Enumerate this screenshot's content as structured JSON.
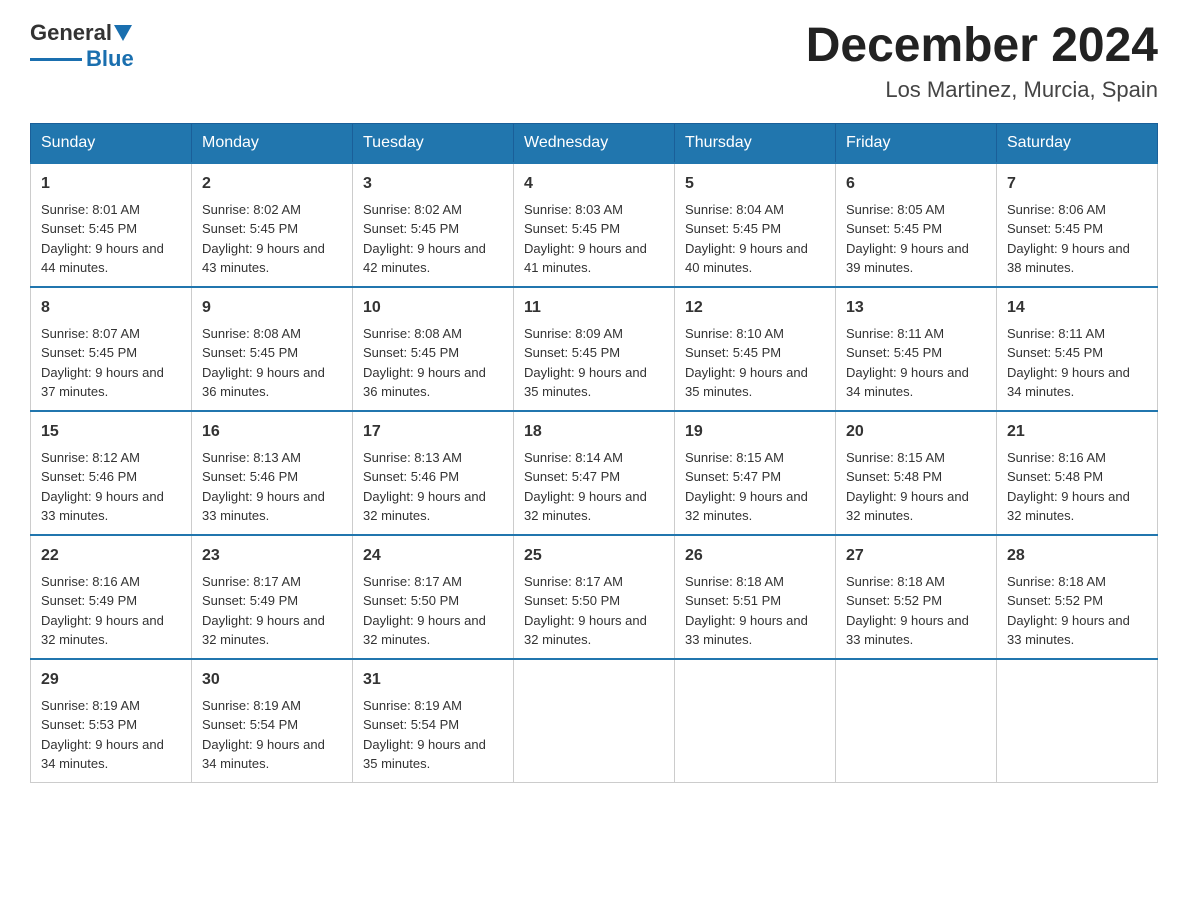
{
  "header": {
    "logo_general": "General",
    "logo_blue": "Blue",
    "month_title": "December 2024",
    "location": "Los Martinez, Murcia, Spain"
  },
  "days_of_week": [
    "Sunday",
    "Monday",
    "Tuesday",
    "Wednesday",
    "Thursday",
    "Friday",
    "Saturday"
  ],
  "weeks": [
    [
      {
        "day": "1",
        "sunrise": "8:01 AM",
        "sunset": "5:45 PM",
        "daylight": "9 hours and 44 minutes."
      },
      {
        "day": "2",
        "sunrise": "8:02 AM",
        "sunset": "5:45 PM",
        "daylight": "9 hours and 43 minutes."
      },
      {
        "day": "3",
        "sunrise": "8:02 AM",
        "sunset": "5:45 PM",
        "daylight": "9 hours and 42 minutes."
      },
      {
        "day": "4",
        "sunrise": "8:03 AM",
        "sunset": "5:45 PM",
        "daylight": "9 hours and 41 minutes."
      },
      {
        "day": "5",
        "sunrise": "8:04 AM",
        "sunset": "5:45 PM",
        "daylight": "9 hours and 40 minutes."
      },
      {
        "day": "6",
        "sunrise": "8:05 AM",
        "sunset": "5:45 PM",
        "daylight": "9 hours and 39 minutes."
      },
      {
        "day": "7",
        "sunrise": "8:06 AM",
        "sunset": "5:45 PM",
        "daylight": "9 hours and 38 minutes."
      }
    ],
    [
      {
        "day": "8",
        "sunrise": "8:07 AM",
        "sunset": "5:45 PM",
        "daylight": "9 hours and 37 minutes."
      },
      {
        "day": "9",
        "sunrise": "8:08 AM",
        "sunset": "5:45 PM",
        "daylight": "9 hours and 36 minutes."
      },
      {
        "day": "10",
        "sunrise": "8:08 AM",
        "sunset": "5:45 PM",
        "daylight": "9 hours and 36 minutes."
      },
      {
        "day": "11",
        "sunrise": "8:09 AM",
        "sunset": "5:45 PM",
        "daylight": "9 hours and 35 minutes."
      },
      {
        "day": "12",
        "sunrise": "8:10 AM",
        "sunset": "5:45 PM",
        "daylight": "9 hours and 35 minutes."
      },
      {
        "day": "13",
        "sunrise": "8:11 AM",
        "sunset": "5:45 PM",
        "daylight": "9 hours and 34 minutes."
      },
      {
        "day": "14",
        "sunrise": "8:11 AM",
        "sunset": "5:45 PM",
        "daylight": "9 hours and 34 minutes."
      }
    ],
    [
      {
        "day": "15",
        "sunrise": "8:12 AM",
        "sunset": "5:46 PM",
        "daylight": "9 hours and 33 minutes."
      },
      {
        "day": "16",
        "sunrise": "8:13 AM",
        "sunset": "5:46 PM",
        "daylight": "9 hours and 33 minutes."
      },
      {
        "day": "17",
        "sunrise": "8:13 AM",
        "sunset": "5:46 PM",
        "daylight": "9 hours and 32 minutes."
      },
      {
        "day": "18",
        "sunrise": "8:14 AM",
        "sunset": "5:47 PM",
        "daylight": "9 hours and 32 minutes."
      },
      {
        "day": "19",
        "sunrise": "8:15 AM",
        "sunset": "5:47 PM",
        "daylight": "9 hours and 32 minutes."
      },
      {
        "day": "20",
        "sunrise": "8:15 AM",
        "sunset": "5:48 PM",
        "daylight": "9 hours and 32 minutes."
      },
      {
        "day": "21",
        "sunrise": "8:16 AM",
        "sunset": "5:48 PM",
        "daylight": "9 hours and 32 minutes."
      }
    ],
    [
      {
        "day": "22",
        "sunrise": "8:16 AM",
        "sunset": "5:49 PM",
        "daylight": "9 hours and 32 minutes."
      },
      {
        "day": "23",
        "sunrise": "8:17 AM",
        "sunset": "5:49 PM",
        "daylight": "9 hours and 32 minutes."
      },
      {
        "day": "24",
        "sunrise": "8:17 AM",
        "sunset": "5:50 PM",
        "daylight": "9 hours and 32 minutes."
      },
      {
        "day": "25",
        "sunrise": "8:17 AM",
        "sunset": "5:50 PM",
        "daylight": "9 hours and 32 minutes."
      },
      {
        "day": "26",
        "sunrise": "8:18 AM",
        "sunset": "5:51 PM",
        "daylight": "9 hours and 33 minutes."
      },
      {
        "day": "27",
        "sunrise": "8:18 AM",
        "sunset": "5:52 PM",
        "daylight": "9 hours and 33 minutes."
      },
      {
        "day": "28",
        "sunrise": "8:18 AM",
        "sunset": "5:52 PM",
        "daylight": "9 hours and 33 minutes."
      }
    ],
    [
      {
        "day": "29",
        "sunrise": "8:19 AM",
        "sunset": "5:53 PM",
        "daylight": "9 hours and 34 minutes."
      },
      {
        "day": "30",
        "sunrise": "8:19 AM",
        "sunset": "5:54 PM",
        "daylight": "9 hours and 34 minutes."
      },
      {
        "day": "31",
        "sunrise": "8:19 AM",
        "sunset": "5:54 PM",
        "daylight": "9 hours and 35 minutes."
      },
      null,
      null,
      null,
      null
    ]
  ],
  "labels": {
    "sunrise": "Sunrise:",
    "sunset": "Sunset:",
    "daylight": "Daylight:"
  }
}
